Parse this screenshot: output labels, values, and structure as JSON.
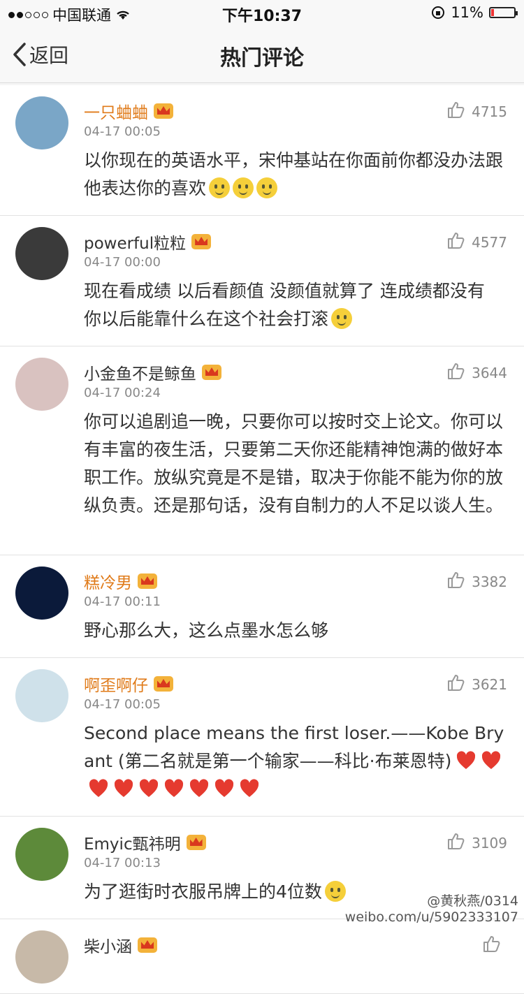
{
  "status_bar": {
    "carrier": "中国联通",
    "time": "下午10:37",
    "battery": "11%",
    "battery_level": 0.11
  },
  "nav": {
    "back_label": "返回",
    "title": "热门评论"
  },
  "comments": [
    {
      "user": "一只蛐蛐",
      "vip": true,
      "time": "04-17 00:05",
      "likes": "4715",
      "text": "以你现在的英语水平，宋仲基站在你面前你都没办法跟他表达你的喜欢",
      "emojis": 3,
      "hearts": 0,
      "avatar_color": "#7aa6c7"
    },
    {
      "user": "powerful粒粒",
      "vip": false,
      "time": "04-17 00:00",
      "likes": "4577",
      "text": "现在看成绩 以后看颜值 没颜值就算了 连成绩都没有 你以后能靠什么在这个社会打滚",
      "emojis": 1,
      "hearts": 0,
      "avatar_color": "#3a3a3a"
    },
    {
      "user": "小金鱼不是鲸鱼",
      "vip": false,
      "time": "04-17 00:24",
      "likes": "3644",
      "text": "你可以追剧追一晚，只要你可以按时交上论文。你可以有丰富的夜生活，只要第二天你还能精神饱满的做好本职工作。放纵究竟是不是错，取决于你能不能为你的放纵负责。还是那句话，没有自制力的人不足以谈人生。",
      "emojis": 0,
      "hearts": 0,
      "avatar_color": "#d9c2c0"
    },
    {
      "user": "糕冷男",
      "vip": true,
      "time": "04-17 00:11",
      "likes": "3382",
      "text": "野心那么大，这么点墨水怎么够",
      "emojis": 0,
      "hearts": 0,
      "avatar_color": "#0b1a3a"
    },
    {
      "user": "啊歪啊仔",
      "vip": true,
      "time": "04-17 00:05",
      "likes": "3621",
      "text": "Second place means the first loser.——Kobe Bryant (第二名就是第一个输家——科比·布莱恩特)",
      "emojis": 0,
      "hearts": 9,
      "avatar_color": "#cfe1ea"
    },
    {
      "user": "Emyic甄祎明",
      "vip": false,
      "time": "04-17 00:13",
      "likes": "3109",
      "text": "为了逛街时衣服吊牌上的4位数",
      "emojis": 1,
      "hearts": 0,
      "avatar_color": "#5d8a3a"
    },
    {
      "user": "柴小涵",
      "vip": false,
      "time": "",
      "likes": "",
      "text": "",
      "emojis": 0,
      "hearts": 0,
      "avatar_color": "#c7b9a8"
    }
  ],
  "watermark": {
    "line1": "@黄秋燕/0314",
    "line2": "weibo.com/u/5902333107"
  }
}
